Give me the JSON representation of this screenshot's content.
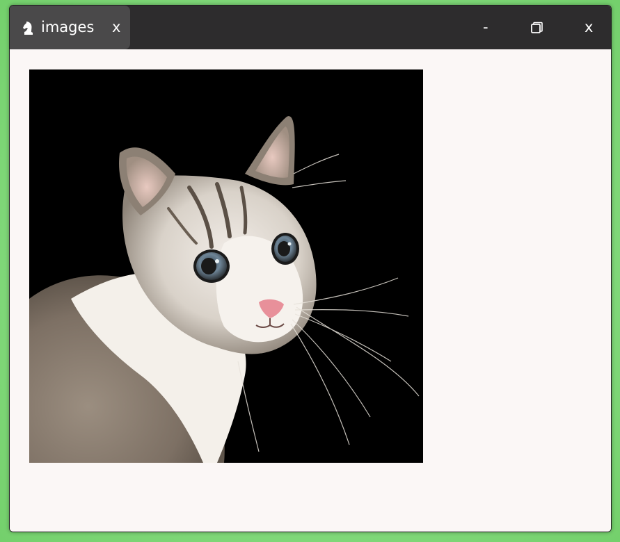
{
  "tab": {
    "icon": "chess-knight-icon",
    "title": "images",
    "close_label": "x"
  },
  "window_controls": {
    "minimize_label": "-",
    "maximize_icon": "maximize-icon",
    "close_label": "x"
  },
  "content": {
    "image_subject": "cat-photo"
  },
  "colors": {
    "titlebar": "#2d2c2d",
    "active_tab": "#4a494a",
    "content_bg": "#fbf7f6",
    "image_bg": "#000000"
  }
}
